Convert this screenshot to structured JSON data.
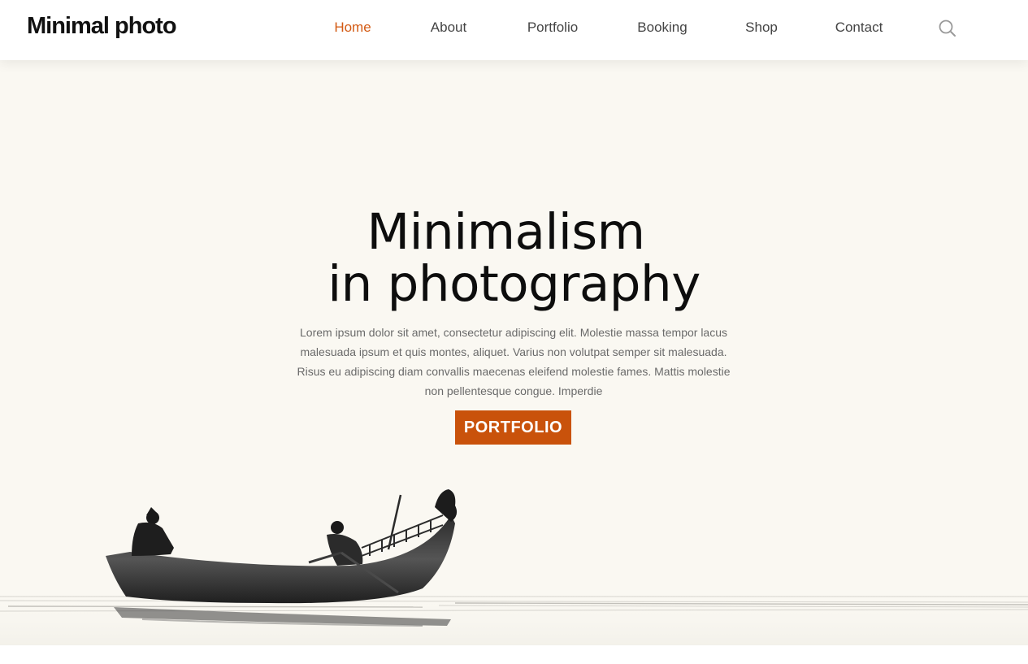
{
  "header": {
    "logo": "Minimal photo",
    "nav": [
      {
        "label": "Home",
        "active": true
      },
      {
        "label": "About",
        "active": false
      },
      {
        "label": "Portfolio",
        "active": false
      },
      {
        "label": "Booking",
        "active": false
      },
      {
        "label": "Shop",
        "active": false
      },
      {
        "label": "Contact",
        "active": false
      }
    ],
    "search_icon": "search-icon"
  },
  "hero": {
    "title_line1": "Minimalism",
    "title_line2": "in photography",
    "description": "Lorem ipsum dolor sit amet, consectetur adipiscing elit. Molestie massa tempor lacus malesuada ipsum et quis montes, aliquet. Varius non volutpat semper sit malesuada. Risus eu adipiscing diam convallis maecenas eleifend molestie fames. Mattis molestie non pellentesque congue. Imperdie",
    "cta_label": "PORTFOLIO",
    "image": "rowing-boat-silhouette"
  },
  "colors": {
    "accent": "#c9520b",
    "active_nav": "#d35a13",
    "hero_bg": "#faf8f2",
    "text_dark": "#0d0d0d"
  }
}
